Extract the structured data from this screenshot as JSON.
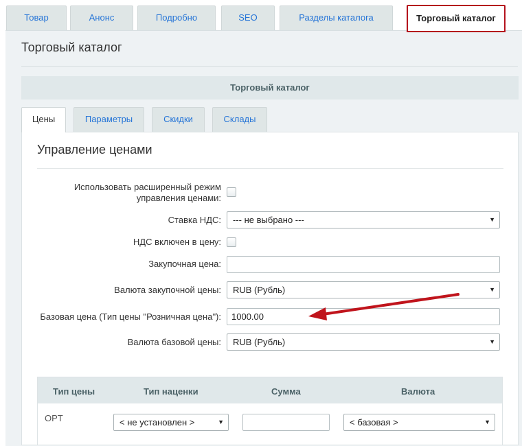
{
  "top_tabs": [
    {
      "label": "Товар"
    },
    {
      "label": "Анонс"
    },
    {
      "label": "Подробно"
    },
    {
      "label": "SEO"
    },
    {
      "label": "Разделы каталога"
    },
    {
      "label": "Торговый каталог",
      "active": true
    }
  ],
  "panel_title": "Торговый каталог",
  "section_header": "Торговый каталог",
  "sub_tabs": [
    {
      "label": "Цены",
      "active": true
    },
    {
      "label": "Параметры"
    },
    {
      "label": "Скидки"
    },
    {
      "label": "Склады"
    }
  ],
  "section_title": "Управление ценами",
  "form": {
    "extended_mode_label_line1": "Использовать расширенный режим",
    "extended_mode_label_line2": "управления ценами:",
    "extended_mode_checked": false,
    "vat_rate_label": "Ставка НДС:",
    "vat_rate_value": "--- не выбрано ---",
    "vat_included_label": "НДС включен в цену:",
    "vat_included_checked": false,
    "purchase_price_label": "Закупочная цена:",
    "purchase_price_value": "",
    "purchase_currency_label": "Валюта закупочной цены:",
    "purchase_currency_value": "RUB (Рубль)",
    "base_price_label": "Базовая цена (Тип цены \"Розничная цена\"):",
    "base_price_value": "1000.00",
    "base_currency_label": "Валюта базовой цены:",
    "base_currency_value": "RUB (Рубль)"
  },
  "price_table": {
    "headers": [
      "Тип цены",
      "Тип наценки",
      "Сумма",
      "Валюта"
    ],
    "rows": [
      {
        "price_type": "OPT",
        "markup_type": "< не установлен >",
        "amount": "",
        "currency": "< базовая >"
      }
    ]
  },
  "annotation": {
    "arrow_color": "#c0141c"
  },
  "colors": {
    "active_tab_border": "#b4111c",
    "link_blue": "#2675d7",
    "panel_bg": "#eef2f4",
    "header_bg": "#e0e8ea"
  }
}
